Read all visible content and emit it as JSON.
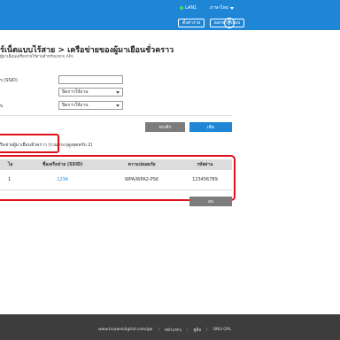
{
  "header": {
    "lan_status": "LAN1",
    "language": "ภาษาไทย",
    "setup_button": "ตั้งค่าง่าย",
    "logout_button": "ออกจากระบบ",
    "help_icon": "?"
  },
  "page": {
    "title": "ร์เน็ตแบบไร้สาย > เครือข่ายของผู้มาเยือนชั่วคราว",
    "subtitle": "ผู้มาเยือนเครือข่ายไร้สายสำหรับแขกๆ APs"
  },
  "form": {
    "ssid_label": "ๆ (SSID)",
    "ssid_value": "",
    "security_label": "",
    "security_value": "ปิดการใช้งาน",
    "sync_label": "ับ",
    "sync_value": "ปิดการใช้งาน",
    "cancel_button": "ยกเลิก",
    "add_button": "เพิ่ม"
  },
  "guest_list": {
    "label": "รือข่ายผู้มาเยือนชั่วคราว (รวมกระบุสูงสุดครับ 2)",
    "columns": [
      "ไอ",
      "ชื่อเครือข่าย (SSID)",
      "ความปลอดภัย",
      "รหัสผ่าน"
    ],
    "rows": [
      {
        "no": "1",
        "ssid": "1234",
        "security": "WPA/WPA2-PSK",
        "password": "123456789"
      }
    ],
    "delete_button": "ลบ"
  },
  "footer": {
    "website": "www.huaweidigital.com/gw",
    "privacy": "หน้าแรกๆ",
    "about": "คู่มือ",
    "license": "ONU GPL"
  }
}
